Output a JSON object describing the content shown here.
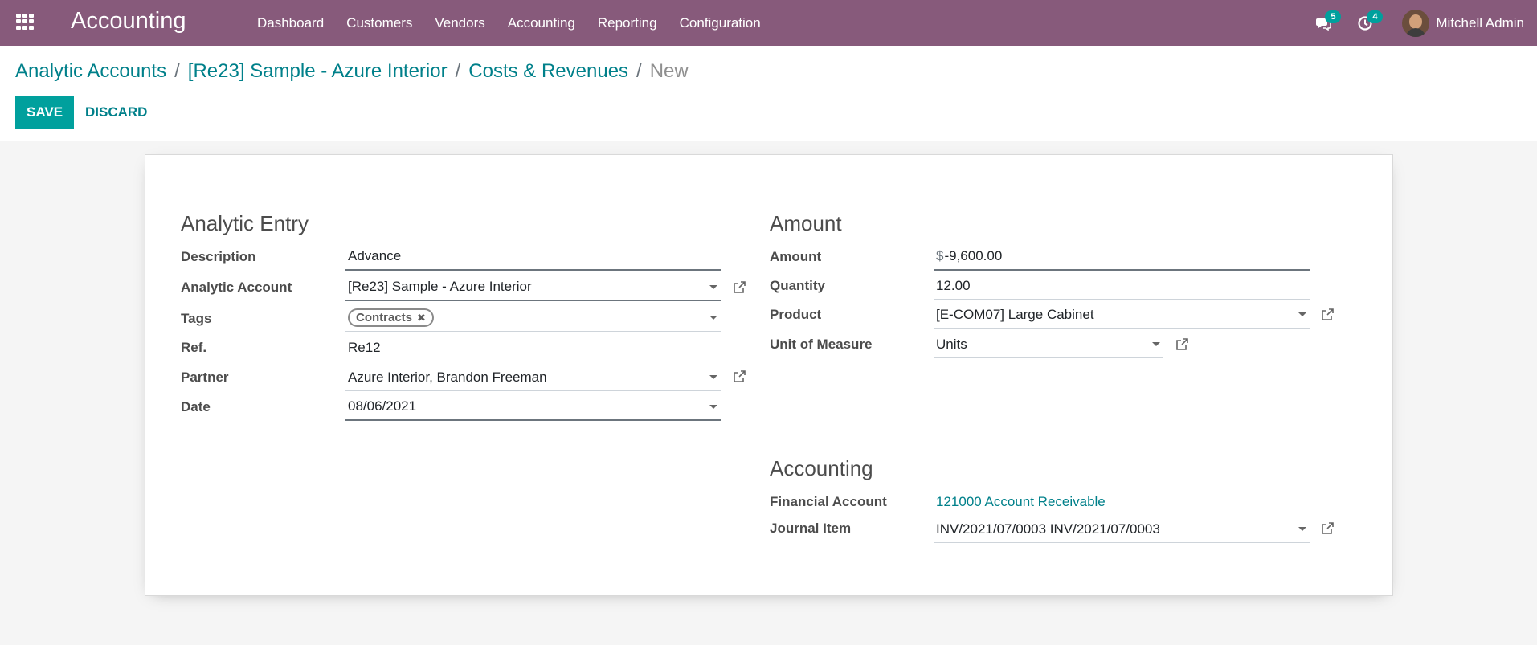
{
  "navbar": {
    "brand": "Accounting",
    "menu": [
      "Dashboard",
      "Customers",
      "Vendors",
      "Accounting",
      "Reporting",
      "Configuration"
    ],
    "messages_count": "5",
    "activities_count": "4",
    "user_name": "Mitchell Admin"
  },
  "breadcrumb": {
    "items": [
      "Analytic Accounts",
      "[Re23] Sample - Azure Interior",
      "Costs & Revenues"
    ],
    "current": "New"
  },
  "actions": {
    "save": "SAVE",
    "discard": "DISCARD"
  },
  "analytic_entry": {
    "title": "Analytic Entry",
    "description": {
      "label": "Description",
      "value": "Advance"
    },
    "analytic_account": {
      "label": "Analytic Account",
      "value": "[Re23] Sample - Azure Interior"
    },
    "tags": {
      "label": "Tags",
      "values": [
        "Contracts"
      ]
    },
    "ref": {
      "label": "Ref.",
      "value": "Re12"
    },
    "partner": {
      "label": "Partner",
      "value": "Azure Interior, Brandon Freeman"
    },
    "date": {
      "label": "Date",
      "value": "08/06/2021"
    }
  },
  "amount": {
    "title": "Amount",
    "amount": {
      "label": "Amount",
      "currency": "$",
      "value": "-9,600.00"
    },
    "quantity": {
      "label": "Quantity",
      "value": "12.00"
    },
    "product": {
      "label": "Product",
      "value": "[E-COM07] Large Cabinet"
    },
    "uom": {
      "label": "Unit of Measure",
      "value": "Units"
    }
  },
  "accounting": {
    "title": "Accounting",
    "financial_account": {
      "label": "Financial Account",
      "value": "121000 Account Receivable"
    },
    "journal_item": {
      "label": "Journal Item",
      "value": "INV/2021/07/0003 INV/2021/07/0003"
    }
  },
  "colors": {
    "navbar": "#875a7b",
    "primary": "#00a09d",
    "link": "#00808a",
    "badge": "#00a09d"
  }
}
